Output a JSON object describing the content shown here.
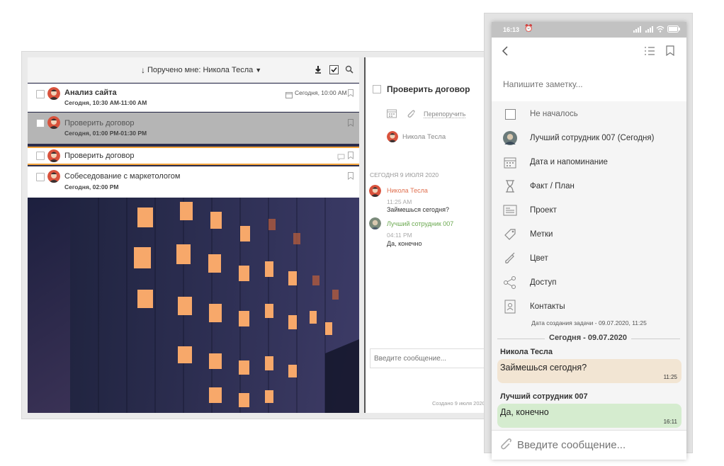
{
  "desktop": {
    "filter_label": "Поручено мне: Никола Тесла",
    "tasks": [
      {
        "title": "Анализ сайта",
        "subtitle": "Сегодня, 10:30 AM-11:00 AM",
        "due": "Сегодня, 10:00 AM"
      },
      {
        "title": "Проверить договор",
        "subtitle": "Сегодня, 01:00 PM-01:30 PM"
      },
      {
        "title": "Проверить договор"
      },
      {
        "title": "Собеседование с маркетологом",
        "subtitle": "Сегодня, 02:00 PM"
      }
    ],
    "detail": {
      "title": "Проверить договор",
      "reassign_label": "Перепоручить",
      "assignee": "Никола Тесла",
      "date_header": "СЕГОДНЯ 9 ИЮЛЯ 2020",
      "messages": [
        {
          "author": "Никола Тесла",
          "time": "11:25 AM",
          "text": "Займешься сегодня?",
          "color": "#e07050"
        },
        {
          "author": "Лучший сотрудник 007",
          "time": "04:11 PM",
          "text": "Да, конечно",
          "color": "#6aa84f"
        }
      ],
      "input_placeholder": "Введите сообщение...",
      "created": "Создано 9 июля 2020"
    }
  },
  "phone": {
    "status_time": "16:13",
    "note_placeholder": "Напишите заметку...",
    "menu": [
      {
        "icon": "checkbox-icon",
        "label": "Не началось"
      },
      {
        "icon": "avatar-icon",
        "label": "Лучший сотрудник 007 (Сегодня)"
      },
      {
        "icon": "calendar-icon",
        "label": "Дата и напоминание"
      },
      {
        "icon": "hourglass-icon",
        "label": "Факт / План"
      },
      {
        "icon": "project-icon",
        "label": "Проект"
      },
      {
        "icon": "tag-icon",
        "label": "Метки"
      },
      {
        "icon": "brush-icon",
        "label": "Цвет"
      },
      {
        "icon": "share-icon",
        "label": "Доступ"
      },
      {
        "icon": "contacts-icon",
        "label": "Контакты"
      }
    ],
    "created_info": "Дата создания задачи - 09.07.2020, 11:25",
    "date_divider": "Сегодня - 09.07.2020",
    "messages": [
      {
        "author": "Никола Тесла",
        "text": "Займешься сегодня?",
        "time": "11:25",
        "color": "#f2e5d3"
      },
      {
        "author": "Лучший сотрудник 007",
        "text": "Да, конечно",
        "time": "16:11",
        "color": "#d5eccf"
      }
    ],
    "input_placeholder": "Введите сообщение..."
  },
  "colors": {
    "accent": "#f4a53c",
    "selected_row": "#b5b5b5",
    "dark_bg": "#2b2d4c"
  }
}
